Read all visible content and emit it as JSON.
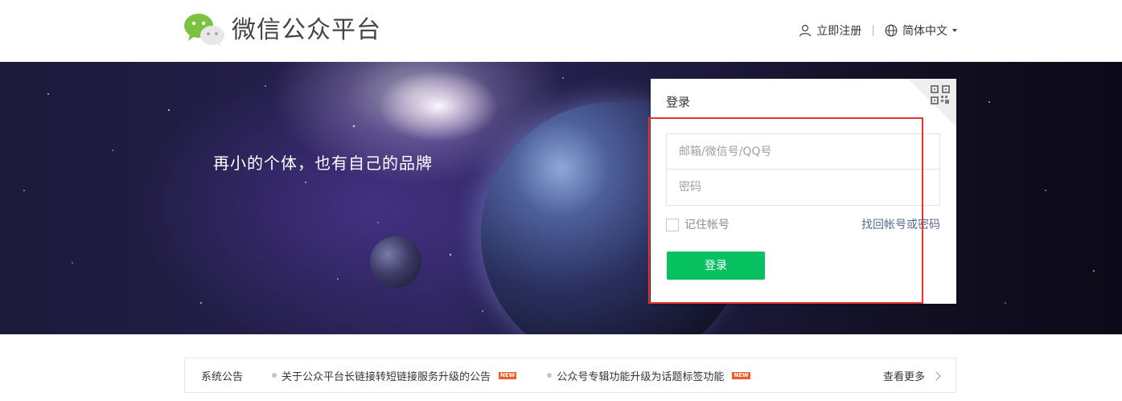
{
  "header": {
    "brand": "微信公众平台",
    "register_label": "立即注册",
    "language_label": "简体中文"
  },
  "banner": {
    "slogan": "再小的个体，也有自己的品牌"
  },
  "login": {
    "title": "登录",
    "account_placeholder": "邮箱/微信号/QQ号",
    "password_placeholder": "密码",
    "remember_label": "记住帐号",
    "forgot_label": "找回帐号或密码",
    "submit_label": "登录"
  },
  "notice": {
    "label": "系统公告",
    "items": [
      {
        "text": "关于公众平台长链接转短链接服务升级的公告",
        "badge": "NEW"
      },
      {
        "text": "公众号专辑功能升级为话题标签功能",
        "badge": "NEW"
      }
    ],
    "more_label": "查看更多"
  },
  "colors": {
    "primary_green": "#07c160",
    "link_blue": "#576b95",
    "highlight_red": "#e5332f",
    "new_badge": "#f15a24"
  }
}
